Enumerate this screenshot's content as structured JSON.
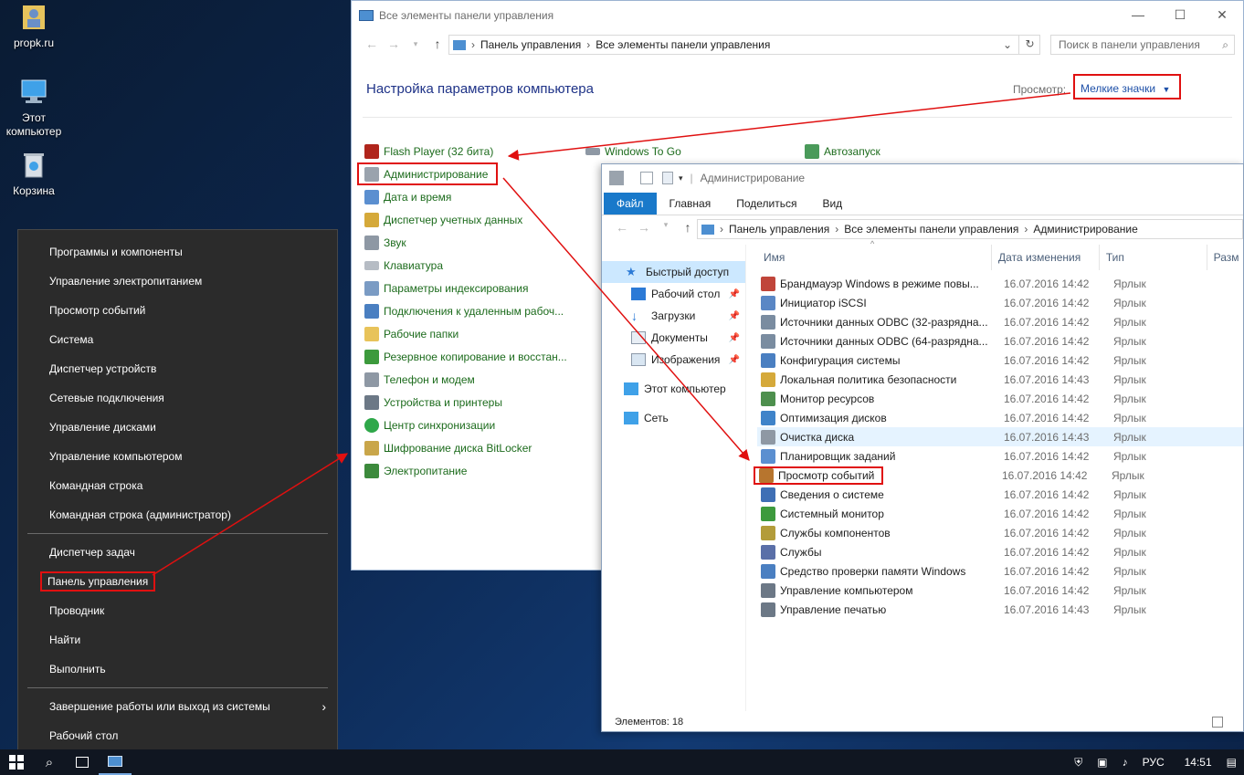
{
  "desktop": {
    "icons": [
      {
        "label": "propk.ru",
        "icon": "user-folder-icon"
      },
      {
        "label": "Этот компьютер",
        "icon": "computer-icon"
      },
      {
        "label": "Корзина",
        "icon": "recycle-bin-icon"
      }
    ]
  },
  "control_panel": {
    "title": "Все элементы панели управления",
    "breadcrumb": [
      "Панель управления",
      "Все элементы панели управления"
    ],
    "search_placeholder": "Поиск в панели управления",
    "heading": "Настройка параметров компьютера",
    "view_label": "Просмотр:",
    "view_value": "Мелкие значки",
    "col1": [
      "Flash Player (32 бита)",
      "Администрирование",
      "Дата и время",
      "Диспетчер учетных данных",
      "Звук",
      "Клавиатура",
      "Параметры индексирования",
      "Подключения к удаленным рабоч...",
      "Рабочие папки",
      "Резервное копирование и восстан...",
      "Телефон и модем",
      "Устройства и принтеры",
      "Центр синхронизации",
      "Шифрование диска BitLocker",
      "Электропитание"
    ],
    "col2_first": "Windows To Go",
    "col3_first": "Автозапуск"
  },
  "explorer": {
    "title": "Администрирование",
    "tabs": [
      "Файл",
      "Главная",
      "Поделиться",
      "Вид"
    ],
    "breadcrumb": [
      "Панель управления",
      "Все элементы панели управления",
      "Администрирование"
    ],
    "sidebar": [
      {
        "label": "Быстрый доступ",
        "pinned": false
      },
      {
        "label": "Рабочий стол",
        "pinned": true
      },
      {
        "label": "Загрузки",
        "pinned": true
      },
      {
        "label": "Документы",
        "pinned": true
      },
      {
        "label": "Изображения",
        "pinned": true
      },
      {
        "label": "Этот компьютер",
        "pinned": false
      },
      {
        "label": "Сеть",
        "pinned": false
      }
    ],
    "columns": [
      "Имя",
      "Дата изменения",
      "Тип",
      "Разм"
    ],
    "rows": [
      {
        "name": "Брандмауэр Windows в режиме повы...",
        "date": "16.07.2016 14:42",
        "type": "Ярлык"
      },
      {
        "name": "Инициатор iSCSI",
        "date": "16.07.2016 14:42",
        "type": "Ярлык"
      },
      {
        "name": "Источники данных ODBC (32-разрядна...",
        "date": "16.07.2016 14:42",
        "type": "Ярлык"
      },
      {
        "name": "Источники данных ODBC (64-разрядна...",
        "date": "16.07.2016 14:42",
        "type": "Ярлык"
      },
      {
        "name": "Конфигурация системы",
        "date": "16.07.2016 14:42",
        "type": "Ярлык"
      },
      {
        "name": "Локальная политика безопасности",
        "date": "16.07.2016 14:43",
        "type": "Ярлык"
      },
      {
        "name": "Монитор ресурсов",
        "date": "16.07.2016 14:42",
        "type": "Ярлык"
      },
      {
        "name": "Оптимизация дисков",
        "date": "16.07.2016 14:42",
        "type": "Ярлык"
      },
      {
        "name": "Очистка диска",
        "date": "16.07.2016 14:43",
        "type": "Ярлык"
      },
      {
        "name": "Планировщик заданий",
        "date": "16.07.2016 14:42",
        "type": "Ярлык"
      },
      {
        "name": "Просмотр событий",
        "date": "16.07.2016 14:42",
        "type": "Ярлык"
      },
      {
        "name": "Сведения о системе",
        "date": "16.07.2016 14:42",
        "type": "Ярлык"
      },
      {
        "name": "Системный монитор",
        "date": "16.07.2016 14:42",
        "type": "Ярлык"
      },
      {
        "name": "Службы компонентов",
        "date": "16.07.2016 14:42",
        "type": "Ярлык"
      },
      {
        "name": "Службы",
        "date": "16.07.2016 14:42",
        "type": "Ярлык"
      },
      {
        "name": "Средство проверки памяти Windows",
        "date": "16.07.2016 14:42",
        "type": "Ярлык"
      },
      {
        "name": "Управление компьютером",
        "date": "16.07.2016 14:42",
        "type": "Ярлык"
      },
      {
        "name": "Управление печатью",
        "date": "16.07.2016 14:43",
        "type": "Ярлык"
      }
    ],
    "status": "Элементов: 18"
  },
  "winx_menu": {
    "group1": [
      "Программы и компоненты",
      "Управление электропитанием",
      "Просмотр событий",
      "Система",
      "Диспетчер устройств",
      "Сетевые подключения",
      "Управление дисками",
      "Управление компьютером",
      "Командная строка",
      "Командная строка (администратор)"
    ],
    "group2": [
      "Диспетчер задач",
      "Панель управления",
      "Проводник",
      "Найти",
      "Выполнить"
    ],
    "group3": [
      "Завершение работы или выход из системы",
      "Рабочий стол"
    ]
  },
  "taskbar": {
    "language": "РУС",
    "time": "14:51"
  },
  "colors": {
    "highlight": "#e01010",
    "link_green": "#1c6b1c",
    "file_tab": "#1979ca"
  }
}
